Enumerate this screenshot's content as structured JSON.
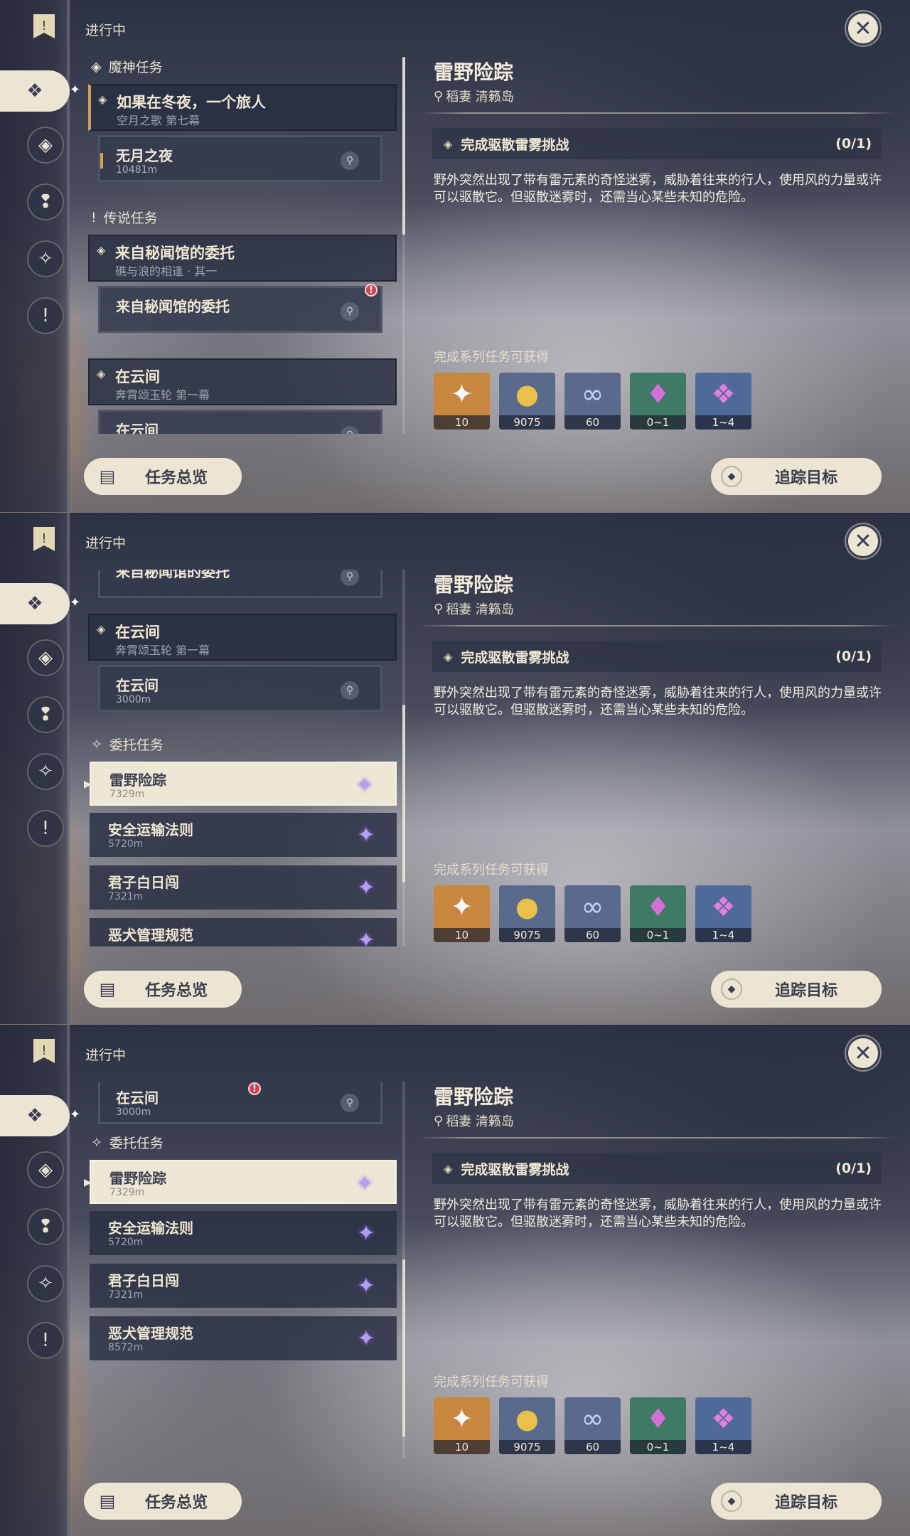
{
  "status_title": "进行中",
  "categories": {
    "archon": "魔神任务",
    "story": "传说任务",
    "commission": "委托任务"
  },
  "archon_quest": {
    "title": "如果在冬夜，一个旅人",
    "subtitle": "空月之歌 第七幕",
    "sub_title": "无月之夜",
    "sub_distance": "10481m"
  },
  "story_quest1": {
    "title": "来自秘闻馆的委托",
    "subtitle": "礁与浪的相逢 · 其一",
    "sub_title": "来自秘闻馆的委托"
  },
  "story_quest2": {
    "title": "在云间",
    "subtitle": "奔霄颂玉轮 第一幕",
    "sub_title": "在云间",
    "sub_distance": "3000m"
  },
  "commissions": [
    {
      "title": "雷野险踪",
      "distance": "7329m"
    },
    {
      "title": "安全运输法则",
      "distance": "5720m"
    },
    {
      "title": "君子白日闯",
      "distance": "7321m"
    },
    {
      "title": "恶犬管理规范",
      "distance": "8572m"
    }
  ],
  "detail": {
    "title": "雷野险踪",
    "location": "稻妻 清籁岛",
    "objective": "完成驱散雷雾挑战",
    "progress": "(0/1)",
    "description": "野外突然出现了带有雷元素的奇怪迷雾，威胁着往来的行人，使用风的力量或许可以驱散它。但驱散迷雾时，还需当心某些未知的危险。",
    "rewards_label": "完成系列任务可获得",
    "rewards": [
      {
        "icon": "primogem-icon",
        "count": "10",
        "color": "#c8873e"
      },
      {
        "icon": "mora-icon",
        "count": "9075",
        "color": "#5a6a8c"
      },
      {
        "icon": "adventure-exp-icon",
        "count": "60",
        "color": "#5a6a8c"
      },
      {
        "icon": "crystal-icon",
        "count": "0~1",
        "color": "#3f7a66"
      },
      {
        "icon": "crystal-cluster-icon",
        "count": "1~4",
        "color": "#4d6a99"
      }
    ]
  },
  "buttons": {
    "overview": "任务总览",
    "track": "追踪目标"
  },
  "scroll_positions": [
    0.0,
    0.45,
    0.6
  ]
}
